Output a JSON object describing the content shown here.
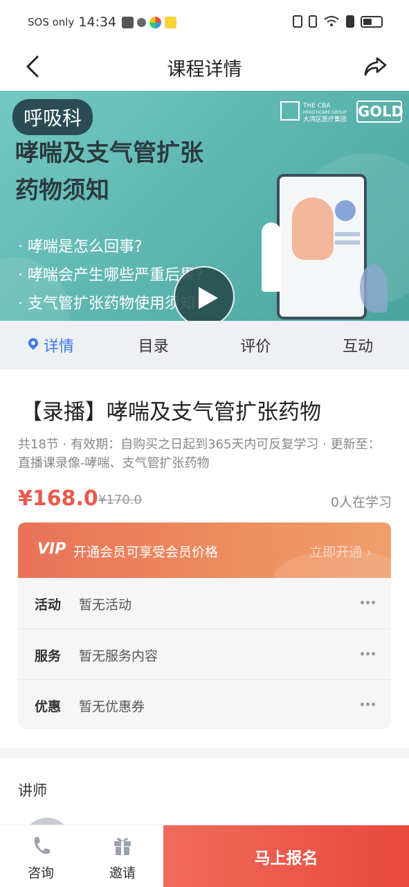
{
  "status_bar": {
    "carrier": "SOS only",
    "time": "14:34"
  },
  "nav": {
    "title": "课程详情",
    "back_icon": "chevron-left-icon",
    "share_icon": "share-icon"
  },
  "banner": {
    "department": "呼吸科",
    "logo1_line1": "THE CBA",
    "logo1_line2": "HEALTHCARE GROUP",
    "logo1_line3": "大湾区医疗集团",
    "logo2": "GOLD",
    "title_line1": "哮喘及支气管扩张",
    "title_line2": "药物须知",
    "bullets": [
      "· 哮喘是怎么回事?",
      "· 哮喘会产生哪些严重后果?",
      "· 支气管扩张药物使用须知?"
    ],
    "play_icon": "play-icon"
  },
  "tabs": [
    {
      "label": "详情",
      "active": true
    },
    {
      "label": "目录",
      "active": false
    },
    {
      "label": "评价",
      "active": false
    },
    {
      "label": "互动",
      "active": false
    }
  ],
  "course": {
    "title": "【录播】哮喘及支气管扩张药物",
    "meta": "共18节 · 有效期：自购买之日起到365天内可反复学习 · 更新至：直播课录像-哮喘、支气管扩张药物",
    "price": "¥168.0",
    "original_price": "¥170.0",
    "learners": "0人在学习"
  },
  "vip": {
    "badge": "VIP",
    "text": "开通会员可享受会员价格",
    "link": "立即开通 ›"
  },
  "info_rows": [
    {
      "label": "活动",
      "value": "暂无活动"
    },
    {
      "label": "服务",
      "value": "暂无服务内容"
    },
    {
      "label": "优惠",
      "value": "暂无优惠券"
    }
  ],
  "teacher": {
    "heading": "讲师"
  },
  "bottom_bar": {
    "consult_label": "咨询",
    "consult_icon": "phone-icon",
    "invite_label": "邀请",
    "invite_icon": "gift-icon",
    "enroll_label": "马上报名"
  },
  "colors": {
    "accent_blue": "#3e7be6",
    "price_red": "#e85a4f",
    "enroll_red": "#e8493d",
    "banner_teal": "#5cb4ae"
  }
}
